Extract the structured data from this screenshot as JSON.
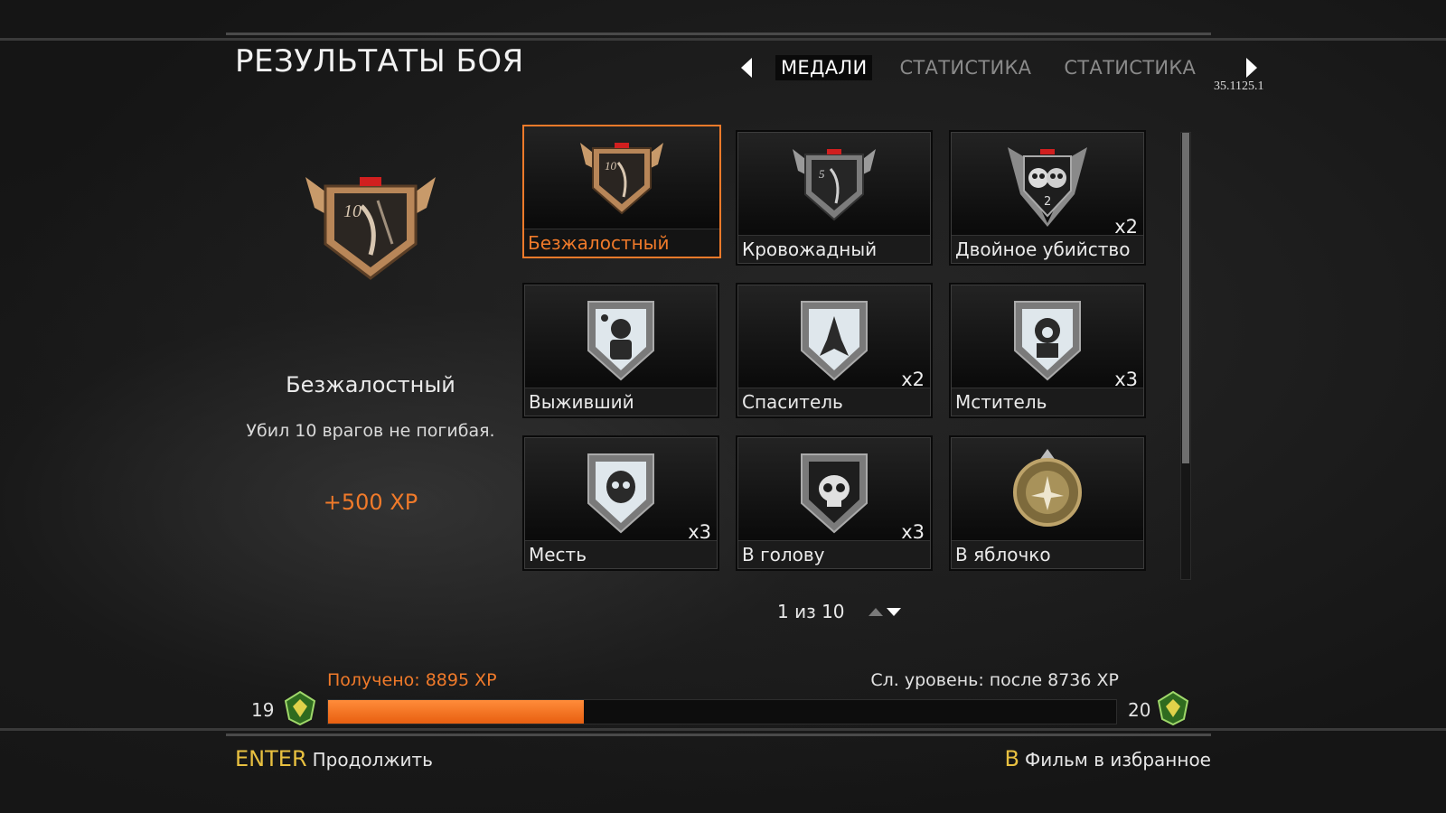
{
  "screen": {
    "title": "РЕЗУЛЬТАТЫ БОЯ",
    "version": "35.1125.1"
  },
  "tabs": [
    {
      "label": "МЕДАЛИ",
      "active": true
    },
    {
      "label": "СТАТИСТИКА",
      "active": false
    },
    {
      "label": "СТАТИСТИКА",
      "active": false
    }
  ],
  "selected_medal": {
    "name": "Безжалостный",
    "description": "Убил 10 врагов не погибая.",
    "xp": "+500 XP"
  },
  "medals": [
    {
      "name": "Безжалостный",
      "count": "",
      "icon": "ruthless-medal-icon",
      "selected": true
    },
    {
      "name": "Кровожадный",
      "count": "",
      "icon": "bloodthirsty-medal-icon",
      "selected": false
    },
    {
      "name": "Двойное убийство",
      "count": "x2",
      "icon": "double-kill-medal-icon",
      "selected": false
    },
    {
      "name": "Выживший",
      "count": "",
      "icon": "survivor-medal-icon",
      "selected": false
    },
    {
      "name": "Спаситель",
      "count": "x2",
      "icon": "savior-medal-icon",
      "selected": false
    },
    {
      "name": "Мститель",
      "count": "x3",
      "icon": "avenger-medal-icon",
      "selected": false
    },
    {
      "name": "Месть",
      "count": "x3",
      "icon": "revenge-medal-icon",
      "selected": false
    },
    {
      "name": "В голову",
      "count": "x3",
      "icon": "headshot-medal-icon",
      "selected": false
    },
    {
      "name": "В яблочко",
      "count": "",
      "icon": "bullseye-medal-icon",
      "selected": false
    }
  ],
  "pager": {
    "text": "1 из 10"
  },
  "progress": {
    "earned": "Получено: 8895 XP",
    "next_level": "Сл. уровень: после 8736 XP",
    "current_level": "19",
    "target_level": "20",
    "fill_fraction": 0.325
  },
  "footer": {
    "continue_key": "ENTER",
    "continue_label": "Продолжить",
    "film_key": "B",
    "film_label": "Фильм в избранное"
  },
  "colors": {
    "accent": "#f07a2a",
    "key": "#e8c040"
  }
}
